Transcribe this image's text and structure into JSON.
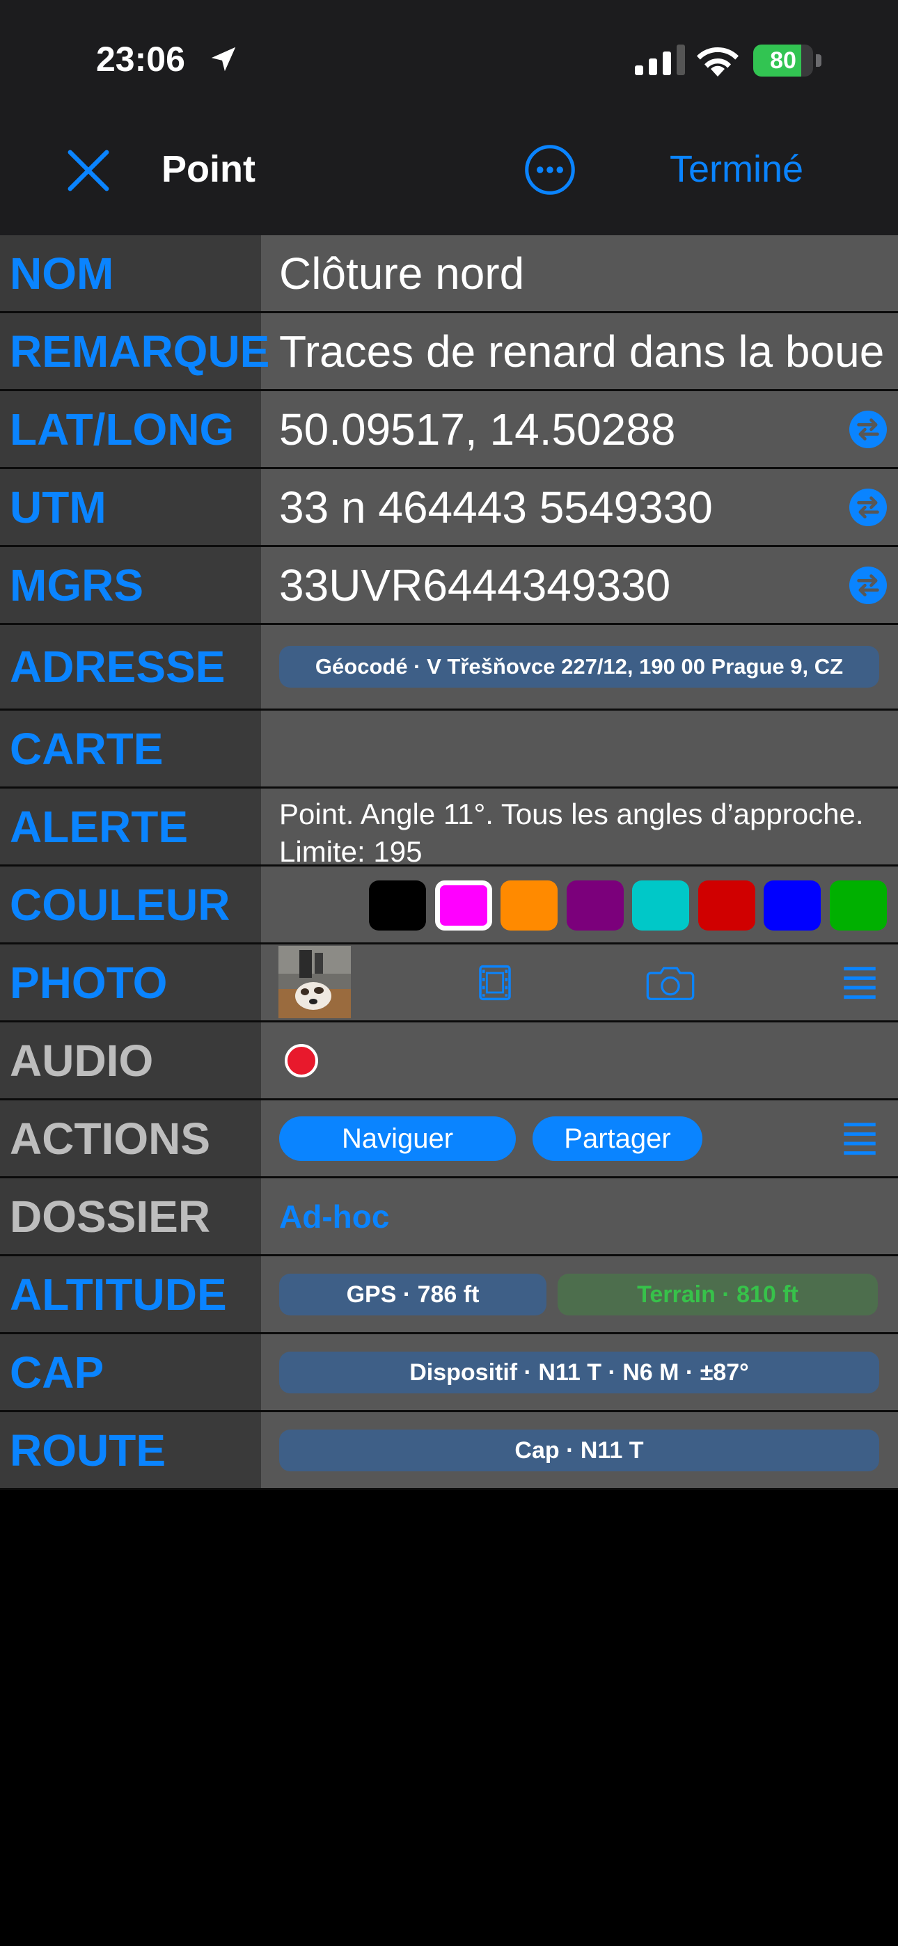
{
  "status_bar": {
    "time": "23:06",
    "battery": "80",
    "battery_level": 0.8,
    "icons": [
      "location-arrow-icon",
      "cellular-signal-icon",
      "wifi-icon",
      "battery-icon"
    ]
  },
  "nav": {
    "title": "Point",
    "done_label": "Terminé",
    "icons": [
      "close-icon",
      "more-icon"
    ]
  },
  "rows": {
    "nom": {
      "label": "NOM",
      "value": "Clôture nord"
    },
    "remarque": {
      "label": "REMARQUE",
      "value": "Traces de renard dans la boue"
    },
    "latlong": {
      "label": "LAT/LONG",
      "value": "50.09517, 14.50288"
    },
    "utm": {
      "label": "UTM",
      "value": "33 n 464443 5549330"
    },
    "mgrs": {
      "label": "MGRS",
      "value": "33UVR6444349330"
    },
    "adresse": {
      "label": "ADRESSE",
      "value": "Géocodé · V Třešňovce 227/12, 190 00 Prague 9, CZ"
    },
    "carte": {
      "label": "CARTE"
    },
    "alerte": {
      "label": "ALERTE",
      "value": "Point. Angle 11°.  Tous les angles d’approche. Limite: 195"
    },
    "couleur": {
      "label": "COULEUR",
      "swatches": [
        "#000000",
        "#ff00ff",
        "#ff8a00",
        "#7b007b",
        "#00c8c8",
        "#d00000",
        "#0000ff",
        "#00b000"
      ],
      "selected_index": 1
    },
    "photo": {
      "label": "PHOTO",
      "icons": [
        "film-icon",
        "camera-icon",
        "list-icon"
      ]
    },
    "audio": {
      "label": "AUDIO"
    },
    "actions": {
      "label": "ACTIONS",
      "naviguer": "Naviguer",
      "partager": "Partager"
    },
    "dossier": {
      "label": "DOSSIER",
      "value": "Ad-hoc"
    },
    "altitude": {
      "label": "ALTITUDE",
      "gps": "GPS · 786 ft",
      "terrain": "Terrain · 810 ft"
    },
    "cap": {
      "label": "CAP",
      "value": "Dispositif · N11 T · N6 M · ±87°"
    },
    "route": {
      "label": "ROUTE",
      "value": "Cap · N11 T"
    }
  },
  "colors": {
    "accent": "#0a84ff",
    "label_bg": "#3a3a3a",
    "value_bg": "#575757",
    "pill_bg": "#3e5f87"
  }
}
